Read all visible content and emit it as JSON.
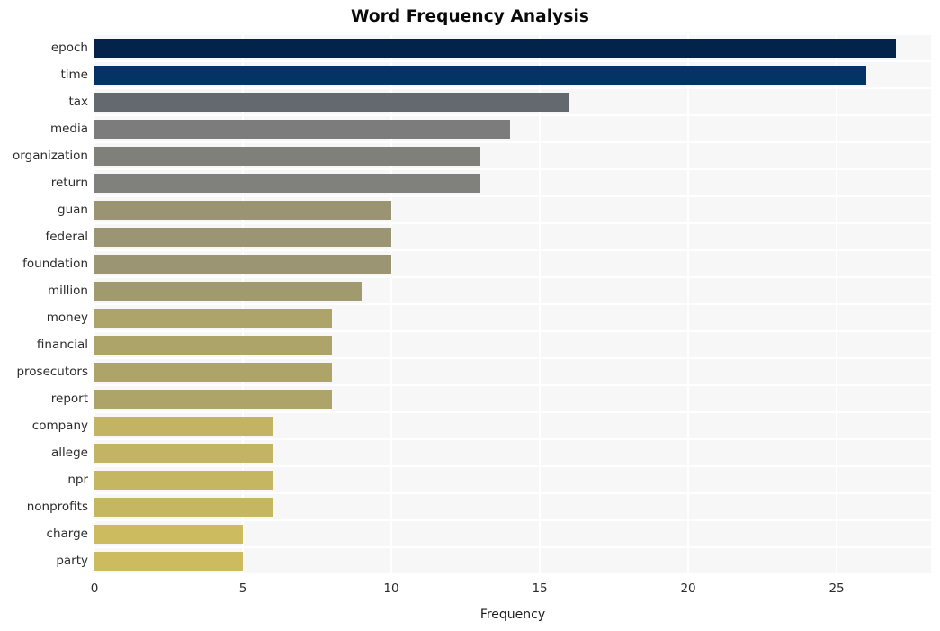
{
  "chart_data": {
    "type": "bar",
    "orientation": "horizontal",
    "title": "Word Frequency Analysis",
    "xlabel": "Frequency",
    "ylabel": "",
    "categories": [
      "epoch",
      "time",
      "tax",
      "media",
      "organization",
      "return",
      "guan",
      "federal",
      "foundation",
      "million",
      "money",
      "financial",
      "prosecutors",
      "report",
      "company",
      "allege",
      "npr",
      "nonprofits",
      "charge",
      "party"
    ],
    "values": [
      27,
      26,
      16,
      14,
      13,
      13,
      10,
      10,
      10,
      9,
      8,
      8,
      8,
      8,
      6,
      6,
      6,
      6,
      5,
      5
    ],
    "bar_colors": [
      "#04234b",
      "#053363",
      "#64686f",
      "#7c7c7c",
      "#80807a",
      "#80807c",
      "#9b9473",
      "#9c9573",
      "#9c9573",
      "#a29a6f",
      "#ada46a",
      "#ada46a",
      "#ada46a",
      "#ada46a",
      "#c2b463",
      "#c2b463",
      "#c5b662",
      "#c5b662",
      "#cdbc5f",
      "#cdbc5f"
    ],
    "xlim": [
      0,
      28.18
    ],
    "ylim_categories": 20,
    "x_ticks": [
      0,
      5,
      10,
      15,
      20,
      25
    ],
    "x_tick_labels": [
      "0",
      "5",
      "10",
      "15",
      "20",
      "25"
    ],
    "grid": true,
    "grid_color": "#ffffff",
    "plot_background": "#f7f7f7",
    "figure_background": "#ffffff",
    "legend": null
  },
  "axis": {
    "x_label": "Frequency",
    "y_label": ""
  },
  "style": {
    "title_color": "#0a0a0a",
    "tick_color": "#2b2b2b",
    "accent": "#04234b"
  }
}
